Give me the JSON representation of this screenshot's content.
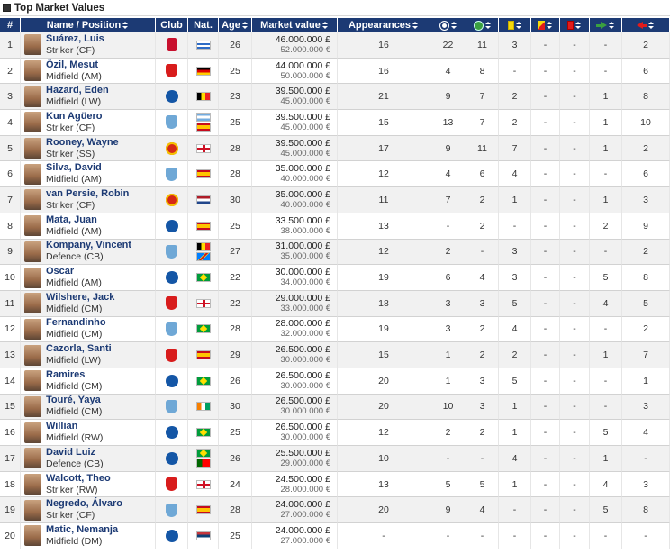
{
  "title": "Top Market Values",
  "columns": {
    "num": "#",
    "name": "Name / Position",
    "club": "Club",
    "nat": "Nat.",
    "age": "Age",
    "mv": "Market value",
    "apps": "Appearances",
    "goals_icon": "football-icon",
    "assists_icon": "assist-icon",
    "yellow_icon": "yellow-card-icon",
    "yellowred_icon": "yellow-red-card-icon",
    "red_icon": "red-card-icon",
    "subin_icon": "sub-in-arrow-icon",
    "subout_icon": "sub-out-arrow-icon"
  },
  "players": [
    {
      "num": "1",
      "name": "Suárez, Luis",
      "pos": "Striker (CF)",
      "club": "liv",
      "nat": [
        "uy"
      ],
      "age": "26",
      "mv": "46.000.000 £",
      "mv2": "52.000.000 €",
      "apps": "16",
      "goals": "22",
      "assists": "11",
      "yellow": "3",
      "yellowred": "-",
      "red": "-",
      "subin": "-",
      "subout": "2"
    },
    {
      "num": "2",
      "name": "Özil, Mesut",
      "pos": "Midfield (AM)",
      "club": "ars",
      "nat": [
        "de"
      ],
      "age": "25",
      "mv": "44.000.000 £",
      "mv2": "50.000.000 €",
      "apps": "16",
      "goals": "4",
      "assists": "8",
      "yellow": "-",
      "yellowred": "-",
      "red": "-",
      "subin": "-",
      "subout": "6"
    },
    {
      "num": "3",
      "name": "Hazard, Eden",
      "pos": "Midfield (LW)",
      "club": "che",
      "nat": [
        "be"
      ],
      "age": "23",
      "mv": "39.500.000 £",
      "mv2": "45.000.000 €",
      "apps": "21",
      "goals": "9",
      "assists": "7",
      "yellow": "2",
      "yellowred": "-",
      "red": "-",
      "subin": "1",
      "subout": "8"
    },
    {
      "num": "4",
      "name": "Kun Agüero",
      "pos": "Striker (CF)",
      "club": "mnc",
      "nat": [
        "ar",
        "es"
      ],
      "age": "25",
      "mv": "39.500.000 £",
      "mv2": "45.000.000 €",
      "apps": "15",
      "goals": "13",
      "assists": "7",
      "yellow": "2",
      "yellowred": "-",
      "red": "-",
      "subin": "1",
      "subout": "10"
    },
    {
      "num": "5",
      "name": "Rooney, Wayne",
      "pos": "Striker (SS)",
      "club": "mnu",
      "nat": [
        "en"
      ],
      "age": "28",
      "mv": "39.500.000 £",
      "mv2": "45.000.000 €",
      "apps": "17",
      "goals": "9",
      "assists": "11",
      "yellow": "7",
      "yellowred": "-",
      "red": "-",
      "subin": "1",
      "subout": "2"
    },
    {
      "num": "6",
      "name": "Silva, David",
      "pos": "Midfield (AM)",
      "club": "mnc",
      "nat": [
        "es"
      ],
      "age": "28",
      "mv": "35.000.000 £",
      "mv2": "40.000.000 €",
      "apps": "12",
      "goals": "4",
      "assists": "6",
      "yellow": "4",
      "yellowred": "-",
      "red": "-",
      "subin": "-",
      "subout": "6"
    },
    {
      "num": "7",
      "name": "van Persie, Robin",
      "pos": "Striker (CF)",
      "club": "mnu",
      "nat": [
        "nl"
      ],
      "age": "30",
      "mv": "35.000.000 £",
      "mv2": "40.000.000 €",
      "apps": "11",
      "goals": "7",
      "assists": "2",
      "yellow": "1",
      "yellowred": "-",
      "red": "-",
      "subin": "1",
      "subout": "3"
    },
    {
      "num": "8",
      "name": "Mata, Juan",
      "pos": "Midfield (AM)",
      "club": "che",
      "nat": [
        "es"
      ],
      "age": "25",
      "mv": "33.500.000 £",
      "mv2": "38.000.000 €",
      "apps": "13",
      "goals": "-",
      "assists": "2",
      "yellow": "-",
      "yellowred": "-",
      "red": "-",
      "subin": "2",
      "subout": "9"
    },
    {
      "num": "9",
      "name": "Kompany, Vincent",
      "pos": "Defence (CB)",
      "club": "mnc",
      "nat": [
        "be",
        "cd"
      ],
      "age": "27",
      "mv": "31.000.000 £",
      "mv2": "35.000.000 €",
      "apps": "12",
      "goals": "2",
      "assists": "-",
      "yellow": "3",
      "yellowred": "-",
      "red": "-",
      "subin": "-",
      "subout": "2"
    },
    {
      "num": "10",
      "name": "Oscar",
      "pos": "Midfield (AM)",
      "club": "che",
      "nat": [
        "br"
      ],
      "age": "22",
      "mv": "30.000.000 £",
      "mv2": "34.000.000 €",
      "apps": "19",
      "goals": "6",
      "assists": "4",
      "yellow": "3",
      "yellowred": "-",
      "red": "-",
      "subin": "5",
      "subout": "8"
    },
    {
      "num": "11",
      "name": "Wilshere, Jack",
      "pos": "Midfield (CM)",
      "club": "ars",
      "nat": [
        "en"
      ],
      "age": "22",
      "mv": "29.000.000 £",
      "mv2": "33.000.000 €",
      "apps": "18",
      "goals": "3",
      "assists": "3",
      "yellow": "5",
      "yellowred": "-",
      "red": "-",
      "subin": "4",
      "subout": "5"
    },
    {
      "num": "12",
      "name": "Fernandinho",
      "pos": "Midfield (CM)",
      "club": "mnc",
      "nat": [
        "br"
      ],
      "age": "28",
      "mv": "28.000.000 £",
      "mv2": "32.000.000 €",
      "apps": "19",
      "goals": "3",
      "assists": "2",
      "yellow": "4",
      "yellowred": "-",
      "red": "-",
      "subin": "-",
      "subout": "2"
    },
    {
      "num": "13",
      "name": "Cazorla, Santi",
      "pos": "Midfield (LW)",
      "club": "ars",
      "nat": [
        "es"
      ],
      "age": "29",
      "mv": "26.500.000 £",
      "mv2": "30.000.000 €",
      "apps": "15",
      "goals": "1",
      "assists": "2",
      "yellow": "2",
      "yellowred": "-",
      "red": "-",
      "subin": "1",
      "subout": "7"
    },
    {
      "num": "14",
      "name": "Ramires",
      "pos": "Midfield (CM)",
      "club": "che",
      "nat": [
        "br"
      ],
      "age": "26",
      "mv": "26.500.000 £",
      "mv2": "30.000.000 €",
      "apps": "20",
      "goals": "1",
      "assists": "3",
      "yellow": "5",
      "yellowred": "-",
      "red": "-",
      "subin": "-",
      "subout": "1"
    },
    {
      "num": "15",
      "name": "Touré, Yaya",
      "pos": "Midfield (CM)",
      "club": "mnc",
      "nat": [
        "ci"
      ],
      "age": "30",
      "mv": "26.500.000 £",
      "mv2": "30.000.000 €",
      "apps": "20",
      "goals": "10",
      "assists": "3",
      "yellow": "1",
      "yellowred": "-",
      "red": "-",
      "subin": "-",
      "subout": "3"
    },
    {
      "num": "16",
      "name": "Willian",
      "pos": "Midfield (RW)",
      "club": "che",
      "nat": [
        "br"
      ],
      "age": "25",
      "mv": "26.500.000 £",
      "mv2": "30.000.000 €",
      "apps": "12",
      "goals": "2",
      "assists": "2",
      "yellow": "1",
      "yellowred": "-",
      "red": "-",
      "subin": "5",
      "subout": "4"
    },
    {
      "num": "17",
      "name": "David Luiz",
      "pos": "Defence (CB)",
      "club": "che",
      "nat": [
        "br",
        "pt"
      ],
      "age": "26",
      "mv": "25.500.000 £",
      "mv2": "29.000.000 €",
      "apps": "10",
      "goals": "-",
      "assists": "-",
      "yellow": "4",
      "yellowred": "-",
      "red": "-",
      "subin": "1",
      "subout": "-"
    },
    {
      "num": "18",
      "name": "Walcott, Theo",
      "pos": "Striker (RW)",
      "club": "ars",
      "nat": [
        "en"
      ],
      "age": "24",
      "mv": "24.500.000 £",
      "mv2": "28.000.000 €",
      "apps": "13",
      "goals": "5",
      "assists": "5",
      "yellow": "1",
      "yellowred": "-",
      "red": "-",
      "subin": "4",
      "subout": "3"
    },
    {
      "num": "19",
      "name": "Negredo, Álvaro",
      "pos": "Striker (CF)",
      "club": "mnc",
      "nat": [
        "es"
      ],
      "age": "28",
      "mv": "24.000.000 £",
      "mv2": "27.000.000 €",
      "apps": "20",
      "goals": "9",
      "assists": "4",
      "yellow": "-",
      "yellowred": "-",
      "red": "-",
      "subin": "5",
      "subout": "8"
    },
    {
      "num": "20",
      "name": "Matic, Nemanja",
      "pos": "Midfield (DM)",
      "club": "che",
      "nat": [
        "rs"
      ],
      "age": "25",
      "mv": "24.000.000 £",
      "mv2": "27.000.000 €",
      "apps": "-",
      "goals": "-",
      "assists": "-",
      "yellow": "-",
      "yellowred": "-",
      "red": "-",
      "subin": "-",
      "subout": "-"
    }
  ]
}
